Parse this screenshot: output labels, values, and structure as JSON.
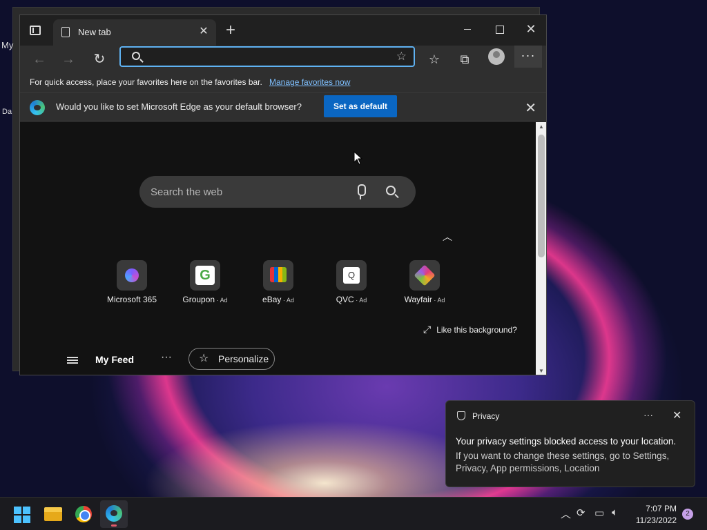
{
  "desktop": {
    "label_1": "My",
    "label_2": "Da"
  },
  "browser": {
    "tab_title": "New tab",
    "address_value": "",
    "favorites_bar": {
      "text": "For quick access, place your favorites here on the favorites bar.",
      "link": "Manage favorites now"
    },
    "default_prompt": {
      "text": "Would you like to set Microsoft Edge as your default browser?",
      "button": "Set as default"
    }
  },
  "newtab": {
    "search_placeholder": "Search the web",
    "tiles": [
      {
        "name": "Microsoft 365",
        "ad": ""
      },
      {
        "name": "Groupon",
        "ad": "Ad"
      },
      {
        "name": "eBay",
        "ad": "Ad"
      },
      {
        "name": "QVC",
        "ad": "Ad"
      },
      {
        "name": "Wayfair",
        "ad": "Ad"
      }
    ],
    "like_background": "Like this background?",
    "feed_title": "My Feed",
    "personalize": "Personalize"
  },
  "toast": {
    "app": "Privacy",
    "heading": "Your privacy settings blocked access to your location.",
    "body": "If you want to change these settings, go to Settings, Privacy, App permissions, Location"
  },
  "taskbar": {
    "time": "7:07 PM",
    "date": "11/23/2022",
    "notification_count": "2"
  },
  "colors": {
    "accent": "#0a66c2",
    "address_focus": "#5fb2f2",
    "windows_blue": "#4cc2ff"
  }
}
